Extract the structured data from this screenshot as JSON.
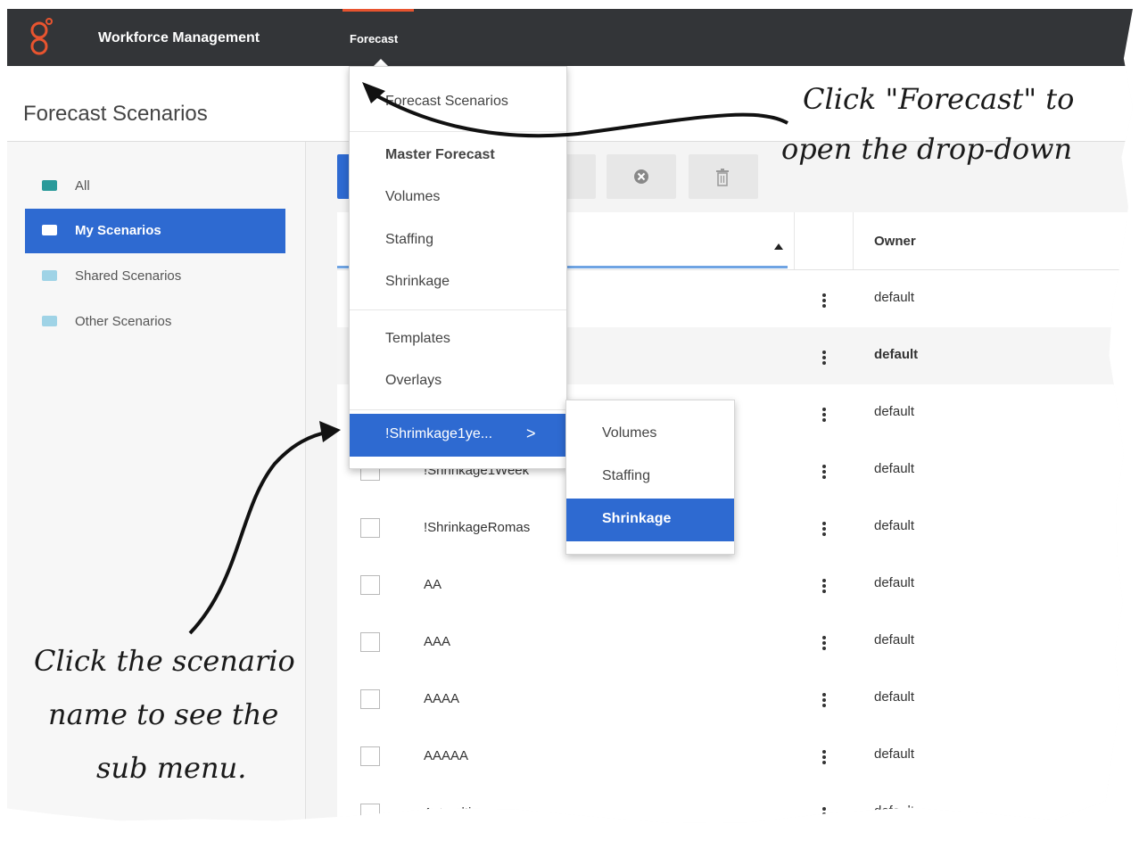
{
  "app": {
    "title": "Workforce Management",
    "nav_forecast": "Forecast",
    "brand_color": "#e8542f",
    "accent_color": "#2e6ad1"
  },
  "page": {
    "title": "Forecast Scenarios"
  },
  "sidebar": {
    "items": [
      {
        "label": "All",
        "icon": "all-folder-icon",
        "active": false
      },
      {
        "label": "My Scenarios",
        "icon": "folder-icon",
        "active": true
      },
      {
        "label": "Shared Scenarios",
        "icon": "folder-icon",
        "active": false
      },
      {
        "label": "Other Scenarios",
        "icon": "folder-icon",
        "active": false
      }
    ]
  },
  "dropdown": {
    "items": [
      {
        "label": "Forecast Scenarios"
      },
      {
        "label": "Master Forecast"
      },
      {
        "label": "Volumes"
      },
      {
        "label": "Staffing"
      },
      {
        "label": "Shrinkage"
      },
      {
        "label": "Templates"
      },
      {
        "label": "Overlays"
      },
      {
        "label": "!Shrimkage1ye...",
        "chevron": ">"
      }
    ]
  },
  "submenu": {
    "items": [
      {
        "label": "Volumes"
      },
      {
        "label": "Staffing"
      },
      {
        "label": "Shrinkage"
      }
    ]
  },
  "table": {
    "owner_header": "Owner",
    "rows": [
      {
        "name": "",
        "owner": "default"
      },
      {
        "name": "",
        "owner": "default"
      },
      {
        "name": "",
        "owner": "default"
      },
      {
        "name": "!Shrinkage1Week",
        "owner": "default"
      },
      {
        "name": "!ShrinkageRomas",
        "owner": "default"
      },
      {
        "name": "AA",
        "owner": "default"
      },
      {
        "name": "AAA",
        "owner": "default"
      },
      {
        "name": "AAAA",
        "owner": "default"
      },
      {
        "name": "AAAAA",
        "owner": "default"
      },
      {
        "name": "Actmulti",
        "owner": "default"
      }
    ]
  },
  "annotations": {
    "forecast_line1": "Click \"Forecast\" to",
    "forecast_line2": "open the drop-down",
    "scenario_line1": "Click the scenario",
    "scenario_line2": "name to see the",
    "scenario_line3": "sub menu."
  }
}
